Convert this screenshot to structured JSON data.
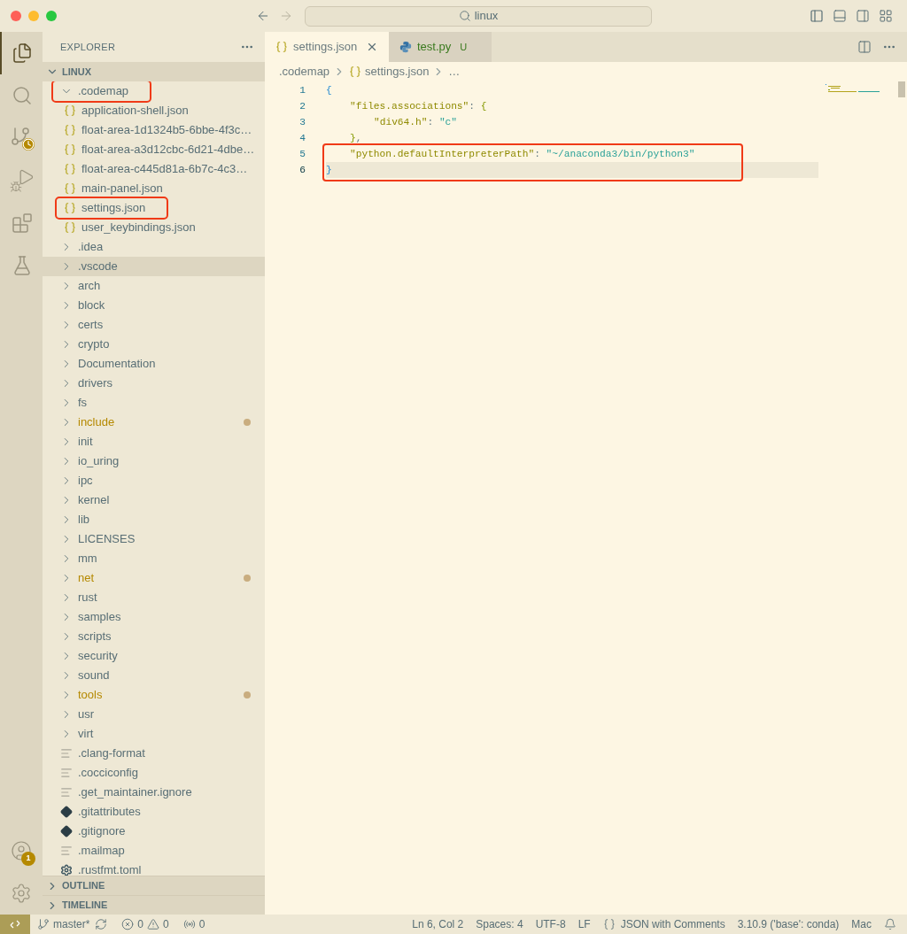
{
  "window": {
    "title": "linux"
  },
  "activity_bar": {
    "items": [
      {
        "kind": "explorer",
        "selected": true
      },
      {
        "kind": "search",
        "selected": false
      },
      {
        "kind": "source_control",
        "selected": false
      },
      {
        "kind": "run",
        "selected": false
      },
      {
        "kind": "extensions",
        "selected": false
      },
      {
        "kind": "testing",
        "selected": false
      }
    ],
    "account_badge": "1"
  },
  "explorer": {
    "title": "EXPLORER",
    "root": {
      "label": "LINUX",
      "expanded": true
    },
    "tree": [
      {
        "label": ".codemap",
        "kind": "folder",
        "expanded": true,
        "selected": false,
        "modified": false,
        "annotated": true,
        "children": [
          {
            "label": "application-shell.json",
            "kind": "json",
            "annotated": false
          },
          {
            "label": "float-area-1d1324b5-6bbe-4f3c…",
            "kind": "json",
            "annotated": false
          },
          {
            "label": "float-area-a3d12cbc-6d21-4dbe…",
            "kind": "json",
            "annotated": false
          },
          {
            "label": "float-area-c445d81a-6b7c-4c3…",
            "kind": "json",
            "annotated": false
          },
          {
            "label": "main-panel.json",
            "kind": "json",
            "annotated": false
          },
          {
            "label": "settings.json",
            "kind": "json",
            "annotated": true
          },
          {
            "label": "user_keybindings.json",
            "kind": "json",
            "annotated": false
          }
        ]
      },
      {
        "label": ".idea",
        "kind": "folder",
        "expanded": false,
        "selected": false,
        "modified": false,
        "annotated": false
      },
      {
        "label": ".vscode",
        "kind": "folder",
        "expanded": false,
        "selected": true,
        "modified": false,
        "annotated": false
      },
      {
        "label": "arch",
        "kind": "folder",
        "expanded": false,
        "selected": false,
        "modified": false,
        "annotated": false
      },
      {
        "label": "block",
        "kind": "folder",
        "expanded": false,
        "selected": false,
        "modified": false,
        "annotated": false
      },
      {
        "label": "certs",
        "kind": "folder",
        "expanded": false,
        "selected": false,
        "modified": false,
        "annotated": false
      },
      {
        "label": "crypto",
        "kind": "folder",
        "expanded": false,
        "selected": false,
        "modified": false,
        "annotated": false
      },
      {
        "label": "Documentation",
        "kind": "folder",
        "expanded": false,
        "selected": false,
        "modified": false,
        "annotated": false
      },
      {
        "label": "drivers",
        "kind": "folder",
        "expanded": false,
        "selected": false,
        "modified": false,
        "annotated": false
      },
      {
        "label": "fs",
        "kind": "folder",
        "expanded": false,
        "selected": false,
        "modified": false,
        "annotated": false
      },
      {
        "label": "include",
        "kind": "folder",
        "expanded": false,
        "selected": false,
        "modified": true,
        "annotated": false
      },
      {
        "label": "init",
        "kind": "folder",
        "expanded": false,
        "selected": false,
        "modified": false,
        "annotated": false
      },
      {
        "label": "io_uring",
        "kind": "folder",
        "expanded": false,
        "selected": false,
        "modified": false,
        "annotated": false
      },
      {
        "label": "ipc",
        "kind": "folder",
        "expanded": false,
        "selected": false,
        "modified": false,
        "annotated": false
      },
      {
        "label": "kernel",
        "kind": "folder",
        "expanded": false,
        "selected": false,
        "modified": false,
        "annotated": false
      },
      {
        "label": "lib",
        "kind": "folder",
        "expanded": false,
        "selected": false,
        "modified": false,
        "annotated": false
      },
      {
        "label": "LICENSES",
        "kind": "folder",
        "expanded": false,
        "selected": false,
        "modified": false,
        "annotated": false
      },
      {
        "label": "mm",
        "kind": "folder",
        "expanded": false,
        "selected": false,
        "modified": false,
        "annotated": false
      },
      {
        "label": "net",
        "kind": "folder",
        "expanded": false,
        "selected": false,
        "modified": true,
        "annotated": false
      },
      {
        "label": "rust",
        "kind": "folder",
        "expanded": false,
        "selected": false,
        "modified": false,
        "annotated": false
      },
      {
        "label": "samples",
        "kind": "folder",
        "expanded": false,
        "selected": false,
        "modified": false,
        "annotated": false
      },
      {
        "label": "scripts",
        "kind": "folder",
        "expanded": false,
        "selected": false,
        "modified": false,
        "annotated": false
      },
      {
        "label": "security",
        "kind": "folder",
        "expanded": false,
        "selected": false,
        "modified": false,
        "annotated": false
      },
      {
        "label": "sound",
        "kind": "folder",
        "expanded": false,
        "selected": false,
        "modified": false,
        "annotated": false
      },
      {
        "label": "tools",
        "kind": "folder",
        "expanded": false,
        "selected": false,
        "modified": true,
        "annotated": false
      },
      {
        "label": "usr",
        "kind": "folder",
        "expanded": false,
        "selected": false,
        "modified": false,
        "annotated": false
      },
      {
        "label": "virt",
        "kind": "folder",
        "expanded": false,
        "selected": false,
        "modified": false,
        "annotated": false
      },
      {
        "label": ".clang-format",
        "kind": "text",
        "annotated": false
      },
      {
        "label": ".cocciconfig",
        "kind": "text",
        "annotated": false
      },
      {
        "label": ".get_maintainer.ignore",
        "kind": "text",
        "annotated": false
      },
      {
        "label": ".gitattributes",
        "kind": "git",
        "annotated": false
      },
      {
        "label": ".gitignore",
        "kind": "git",
        "annotated": false
      },
      {
        "label": ".mailmap",
        "kind": "text",
        "annotated": false
      },
      {
        "label": ".rustfmt.toml",
        "kind": "config",
        "annotated": false
      }
    ],
    "sections": [
      {
        "label": "OUTLINE",
        "expanded": false
      },
      {
        "label": "TIMELINE",
        "expanded": false
      }
    ]
  },
  "editor": {
    "tabs": [
      {
        "label": "settings.json",
        "kind": "json",
        "selected": true
      },
      {
        "label": "test.py",
        "kind": "python",
        "selected": false,
        "status": "U"
      }
    ],
    "breadcrumb": [
      {
        "label": ".codemap",
        "kind": "folder"
      },
      {
        "label": "settings.json",
        "kind": "json"
      },
      {
        "label": "…",
        "kind": "symbol"
      }
    ],
    "lines": [
      {
        "number": "1",
        "current": false,
        "annotated": false,
        "tokens": [
          {
            "text": "{",
            "kind": "bracket_outer"
          }
        ]
      },
      {
        "number": "2",
        "current": false,
        "annotated": false,
        "tokens": [
          {
            "text": "\"files.associations\"",
            "kind": "key"
          },
          {
            "text": ": ",
            "kind": "punct"
          },
          {
            "text": "{",
            "kind": "bracket_inner"
          }
        ]
      },
      {
        "number": "3",
        "current": false,
        "annotated": false,
        "tokens": [
          {
            "text": "\"div64.h\"",
            "kind": "key"
          },
          {
            "text": ": ",
            "kind": "punct"
          },
          {
            "text": "\"c\"",
            "kind": "string"
          }
        ]
      },
      {
        "number": "4",
        "current": false,
        "annotated": false,
        "tokens": [
          {
            "text": "}",
            "kind": "bracket_inner"
          },
          {
            "text": ",",
            "kind": "punct"
          }
        ]
      },
      {
        "number": "5",
        "current": false,
        "annotated": true,
        "tokens": [
          {
            "text": "\"python.defaultInterpreterPath\"",
            "kind": "key"
          },
          {
            "text": ": ",
            "kind": "punct"
          },
          {
            "text": "\"~/anaconda3/bin/python3\"",
            "kind": "string"
          }
        ]
      },
      {
        "number": "6",
        "current": true,
        "annotated": true,
        "tokens": [
          {
            "text": "}",
            "kind": "bracket_outer"
          }
        ]
      }
    ]
  },
  "status_bar": {
    "branch": "master*",
    "errors": "0",
    "warnings": "0",
    "ports": "0",
    "right": [
      {
        "text": "Ln 6, Col 2",
        "kind": "plain"
      },
      {
        "text": "Spaces: 4",
        "kind": "plain"
      },
      {
        "text": "UTF-8",
        "kind": "plain"
      },
      {
        "text": "LF",
        "kind": "plain"
      },
      {
        "text": "JSON with Comments",
        "kind": "language"
      },
      {
        "text": "3.10.9 ('base': conda)",
        "kind": "plain"
      },
      {
        "text": "Mac",
        "kind": "plain"
      }
    ]
  }
}
